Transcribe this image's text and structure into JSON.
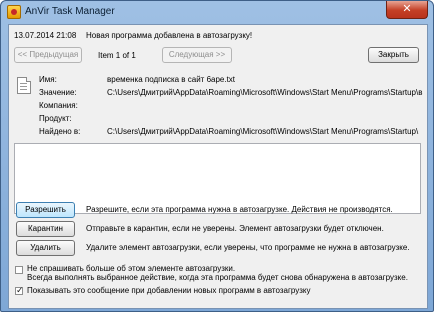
{
  "window": {
    "title": "AnVir Task Manager",
    "close_glyph": "✕"
  },
  "header": {
    "date": "13.07.2014 21:08",
    "message": "Новая программа добавлена в автозагрузку!"
  },
  "navigation": {
    "prev_label": "<< Предыдущая",
    "counter": "Item 1 of 1",
    "next_label": "Следующая >>",
    "close_label": "Закрыть"
  },
  "details": {
    "name_label": "Имя:",
    "name_value": "временка подписка в сайт 6ape.txt",
    "value_label": "Значение:",
    "value_value": "C:\\Users\\Дмитрий\\AppData\\Roaming\\Microsoft\\Windows\\Start Menu\\Programs\\Startup\\вре",
    "company_label": "Компания:",
    "company_value": "",
    "product_label": "Продукт:",
    "product_value": "",
    "found_label": "Найдено в:",
    "found_value": "C:\\Users\\Дмитрий\\AppData\\Roaming\\Microsoft\\Windows\\Start Menu\\Programs\\Startup\\"
  },
  "notes_text": "",
  "actions": {
    "allow_label": "Разрешить",
    "allow_desc": "Разрешите, если эта программа нужна в автозагрузке. Действия не производятся.",
    "quarantine_label": "Карантин",
    "quarantine_desc": "Отправьте в карантин, если не уверены. Элемент автозагрузки будет отключен.",
    "delete_label": "Удалить",
    "delete_desc": "Удалите элемент автозагрузки, если уверены, что программе не нужна в автозагрузке."
  },
  "options": {
    "dont_ask_label1": "Не спрашивать больше об этом элементе автозагрузки.",
    "dont_ask_label2": "Всегда выполнять выбранное действие, когда эта программа будет снова обнаружена в автозагрузке.",
    "dont_ask_checked": false,
    "show_msg_label": "Показывать это сообщение при добавлении новых программ в автозагрузку",
    "show_msg_checked": true
  },
  "colors": {
    "frame": "#8fb3de",
    "client_bg": "#f0f0f0",
    "close_button": "#c43f25"
  }
}
